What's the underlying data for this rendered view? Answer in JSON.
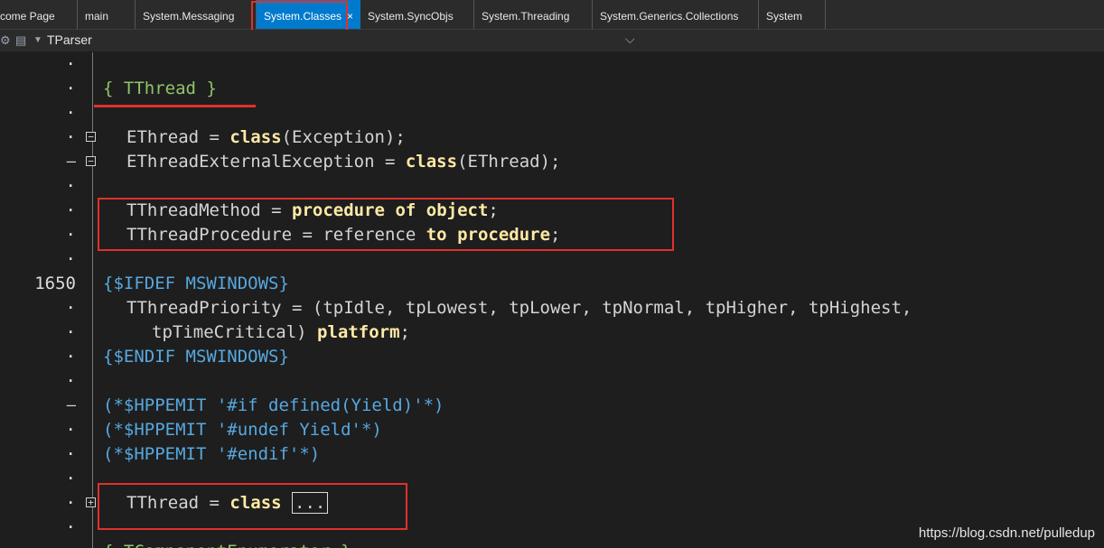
{
  "tabs": [
    {
      "label": "come Page"
    },
    {
      "label": "main"
    },
    {
      "label": "System.Messaging"
    },
    {
      "label": "System.Classes",
      "close": "×"
    },
    {
      "label": "System.SyncObjs"
    },
    {
      "label": "System.Threading"
    },
    {
      "label": "System.Generics.Collections"
    },
    {
      "label": "System"
    }
  ],
  "nav": {
    "title": "TParser",
    "chevron": "⌵"
  },
  "lines": [
    {
      "gutter": "·",
      "code": ""
    },
    {
      "gutter": "·",
      "code": "{ TThread }"
    },
    {
      "gutter": "·",
      "code": ""
    },
    {
      "gutter": "·",
      "code": "EThread = class(Exception);"
    },
    {
      "gutter": "–",
      "code": "EThreadExternalException = class(EThread);"
    },
    {
      "gutter": "·",
      "code": ""
    },
    {
      "gutter": "·",
      "code": "TThreadMethod = procedure of object;"
    },
    {
      "gutter": "·",
      "code": "TThreadProcedure = reference to procedure;"
    },
    {
      "gutter": "·",
      "code": ""
    },
    {
      "gutter": "1650",
      "code": "{$IFDEF MSWINDOWS}"
    },
    {
      "gutter": "·",
      "code": "TThreadPriority = (tpIdle, tpLowest, tpLower, tpNormal, tpHigher, tpHighest,"
    },
    {
      "gutter": "·",
      "code": "tpTimeCritical) platform;"
    },
    {
      "gutter": "·",
      "code": "{$ENDIF MSWINDOWS}"
    },
    {
      "gutter": "·",
      "code": ""
    },
    {
      "gutter": "–",
      "code": "(*$HPPEMIT '#if defined(Yield)'*)"
    },
    {
      "gutter": "·",
      "code": "(*$HPPEMIT '#undef Yield'*)"
    },
    {
      "gutter": "·",
      "code": "(*$HPPEMIT '#endif'*)"
    },
    {
      "gutter": "·",
      "code": ""
    },
    {
      "gutter": "·",
      "code": "TThread = class ..."
    },
    {
      "gutter": "·",
      "code": ""
    },
    {
      "gutter": "",
      "code": "{ TComponentEnumerator }"
    }
  ],
  "watermark": "https://blog.csdn.net/pulledup",
  "colors": {
    "background": "#1e1e1e",
    "active_tab": "#007acc",
    "annotation": "#e0312a",
    "keyword": "#ffe9a6",
    "comment": "#8fc56a",
    "directive": "#56a8e0"
  }
}
